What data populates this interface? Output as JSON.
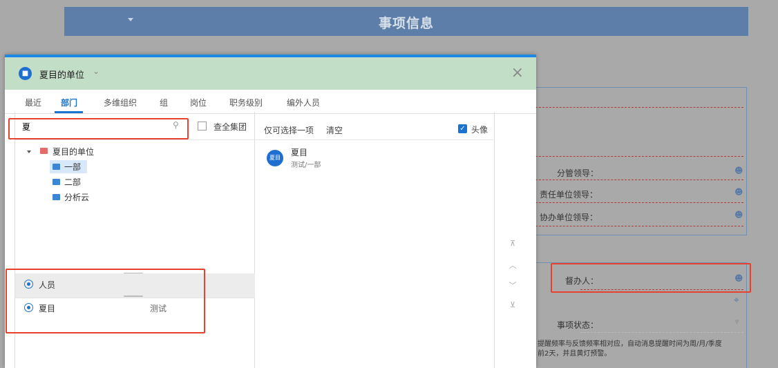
{
  "background": {
    "header_title": "事项信息",
    "fields": {
      "leader": "分管领导：",
      "responsible_leader": "责任单位领导：",
      "assist_leader": "协办单位领导：",
      "supervisor": "督办人：",
      "status": "事项状态：",
      "note_line1": "提醒频率与反馈频率相对应，自动消息提醒时间为周/月/季度",
      "note_line2": "前2天，并且黄灯预警。"
    }
  },
  "dialog": {
    "unit_name": "夏目的单位",
    "tabs": [
      "最近",
      "部门",
      "多维组织",
      "组",
      "岗位",
      "职务级别",
      "编外人员"
    ],
    "active_tab": "部门",
    "search": {
      "value": "夏",
      "placeholder": ""
    },
    "search_group_label": "查全集团",
    "tree": {
      "root": "夏目的单位",
      "children": [
        "一部",
        "二部",
        "分析云"
      ]
    },
    "select_header": {
      "only_one": "仅可选择一项",
      "clear": "清空",
      "avatar_label": "头像"
    },
    "result": {
      "avatar_text": "夏目",
      "name": "夏目",
      "path": "测试/一部"
    },
    "selected_section": {
      "person_label": "人员",
      "person_name": "夏目",
      "person_dept": "测试"
    },
    "scroll_buttons": [
      "⊼",
      "︿",
      "﹀",
      "⊻"
    ]
  },
  "colors": {
    "accent": "#1a73d0",
    "highlight": "#e8402f",
    "header_green": "#c2dec6"
  }
}
